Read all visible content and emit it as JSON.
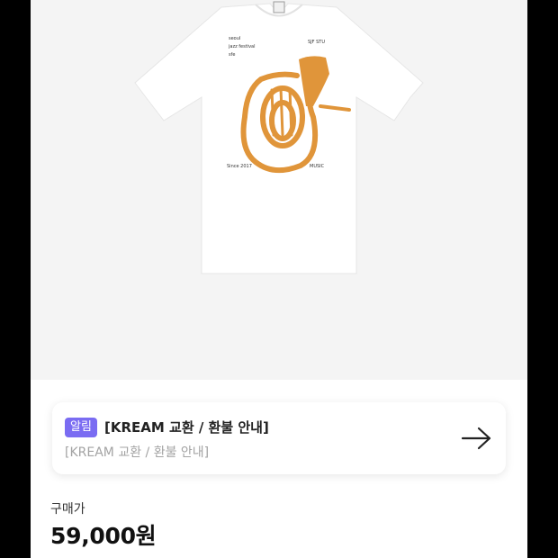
{
  "product": {
    "image": {
      "shirt_color": "#ffffff",
      "print_color": "#e0953a",
      "print_lines": [
        "seoul",
        "jazz festival",
        "sfe"
      ],
      "print_tag_top": "SJF STU",
      "print_since": "Since 2017",
      "print_music": "MUSIC"
    }
  },
  "notice": {
    "badge": "알림",
    "title": "[KREAM 교환 / 환불 안내]",
    "subtitle": "[KREAM 교환 / 환불 안내]",
    "badge_color": "#7a6cf2",
    "icon": "arrow-right-icon"
  },
  "price": {
    "label": "구매가",
    "value": "59,000원"
  }
}
